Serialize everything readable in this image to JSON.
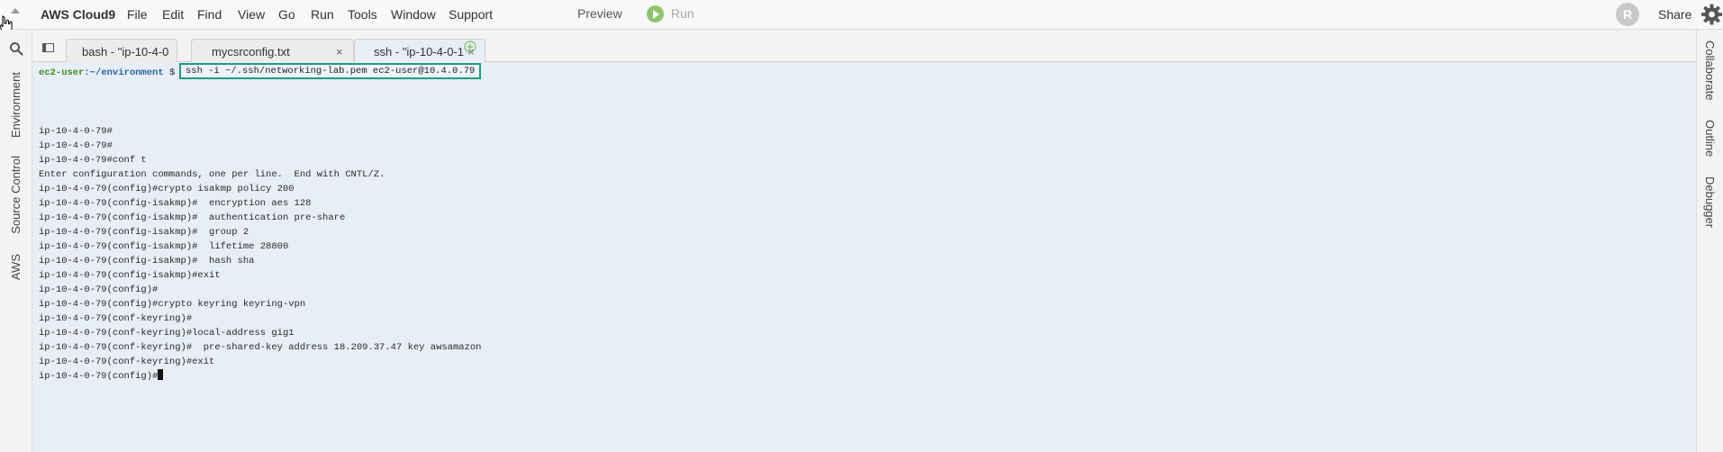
{
  "menubar": {
    "brand": "AWS Cloud9",
    "menu_items": [
      "File",
      "Edit",
      "Find",
      "View",
      "Go",
      "Run",
      "Tools",
      "Window",
      "Support"
    ],
    "preview_label": "Preview",
    "run_label": "Run",
    "avatar_initial": "R",
    "share_label": "Share"
  },
  "left_sidebar": {
    "tabs": [
      "Environment",
      "Source Control",
      "AWS"
    ]
  },
  "right_sidebar": {
    "tabs": [
      "Collaborate",
      "Outline",
      "Debugger"
    ]
  },
  "tabs": [
    {
      "label": "bash - \"ip-10-4-0",
      "close": "×"
    },
    {
      "label": "mycsrconfig.txt",
      "close": "×"
    },
    {
      "label": "ssh - \"ip-10-4-0-1",
      "close": "×"
    }
  ],
  "terminal": {
    "prompt_user": "ec2-user",
    "prompt_path": ":~/environment",
    "prompt_symbol": " $",
    "command": "ssh -i ~/.ssh/networking-lab.pem ec2-user@10.4.0.79",
    "output_lines": [
      "ip-10-4-0-79#",
      "ip-10-4-0-79#",
      "ip-10-4-0-79#conf t",
      "Enter configuration commands, one per line.  End with CNTL/Z.",
      "ip-10-4-0-79(config)#crypto isakmp policy 200",
      "ip-10-4-0-79(config-isakmp)#  encryption aes 128",
      "ip-10-4-0-79(config-isakmp)#  authentication pre-share",
      "ip-10-4-0-79(config-isakmp)#  group 2",
      "ip-10-4-0-79(config-isakmp)#  lifetime 28800",
      "ip-10-4-0-79(config-isakmp)#  hash sha",
      "ip-10-4-0-79(config-isakmp)#exit",
      "ip-10-4-0-79(config)#",
      "ip-10-4-0-79(config)#crypto keyring keyring-vpn",
      "ip-10-4-0-79(conf-keyring)#",
      "ip-10-4-0-79(conf-keyring)#local-address gig1",
      "ip-10-4-0-79(conf-keyring)#  pre-shared-key address 18.209.37.47 key awsamazon",
      "ip-10-4-0-79(conf-keyring)#exit"
    ],
    "current_prompt": "ip-10-4-0-79(config)#"
  },
  "colors": {
    "terminal_bg": "#e8eef6",
    "highlight_border": "#1a9d84",
    "prompt_user": "#3e8e1c",
    "prompt_path": "#2c61a8",
    "run_icon": "#8cc56a"
  },
  "icons": {
    "search": "search-icon",
    "gear": "gear-icon",
    "run": "play-icon",
    "add_tab": "plus-circle-icon",
    "pane_menu": "pane-menu-icon",
    "collapse": "chevron-up-icon",
    "cursor": "mouse-pointer-icon"
  }
}
